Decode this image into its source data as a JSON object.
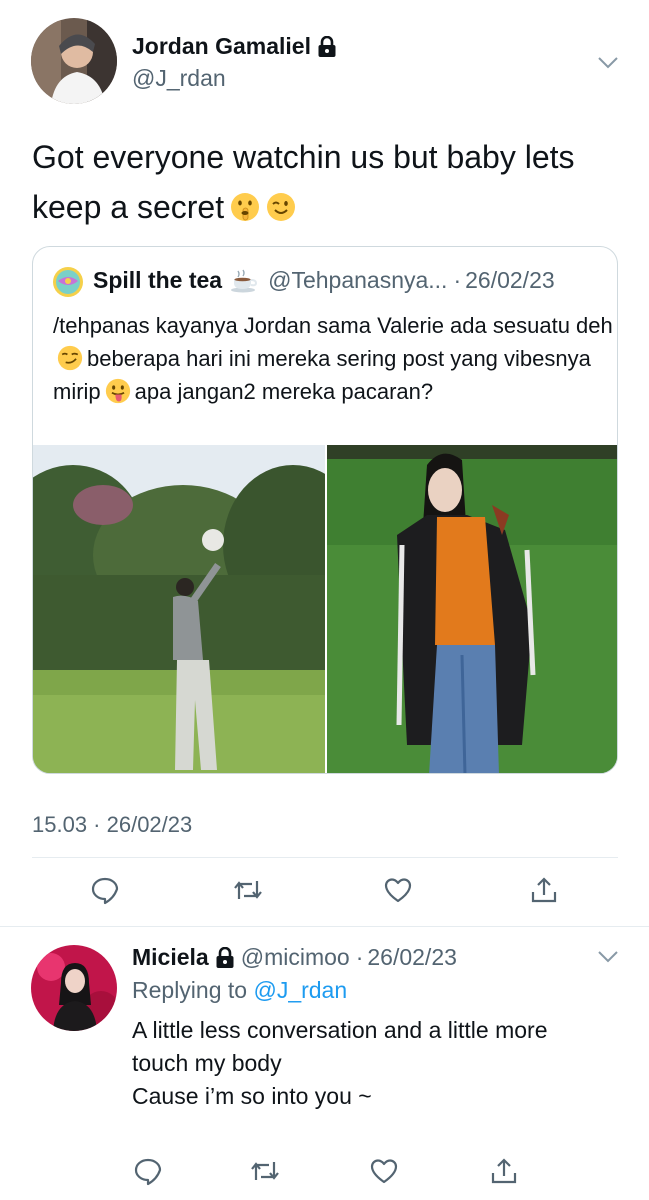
{
  "tweet": {
    "author_name": "Jordan Gamaliel",
    "author_handle": "@J_rdan",
    "text": "Got everyone watchin us but baby lets keep a secret",
    "emojis": [
      "shushing-face",
      "winking-face"
    ],
    "timestamp": "15.03 · 26/02/23"
  },
  "quote": {
    "author_name": "Spill the tea",
    "author_emoji": "hot-beverage",
    "author_handle": "@Tehpanasnya...",
    "separator": "·",
    "date": "26/02/23",
    "text_part1": "/tehpanas kayanya Jordan sama Valerie ada sesuatu deh",
    "text_part2": "beberapa hari ini mereka sering post yang vibesnya mirip",
    "text_part3": "apa jangan2 mereka pacaran?",
    "emojis": [
      "smirking-face",
      "face-with-tongue"
    ]
  },
  "actions": [
    "reply-icon",
    "retweet-icon",
    "like-icon",
    "share-icon"
  ],
  "reply": {
    "author_name": "Miciela",
    "author_handle": "@micimoo",
    "separator": "·",
    "date": "26/02/23",
    "replying_label": "Replying to",
    "replying_mention": "@J_rdan",
    "line1": "A little less conversation and a little more",
    "line2": "touch my body",
    "line3": "Cause i’m so into you ~"
  },
  "colors": {
    "text": "#0f1419",
    "secondary": "#536471",
    "link": "#1d9bf0",
    "border": "#cfd9de"
  }
}
